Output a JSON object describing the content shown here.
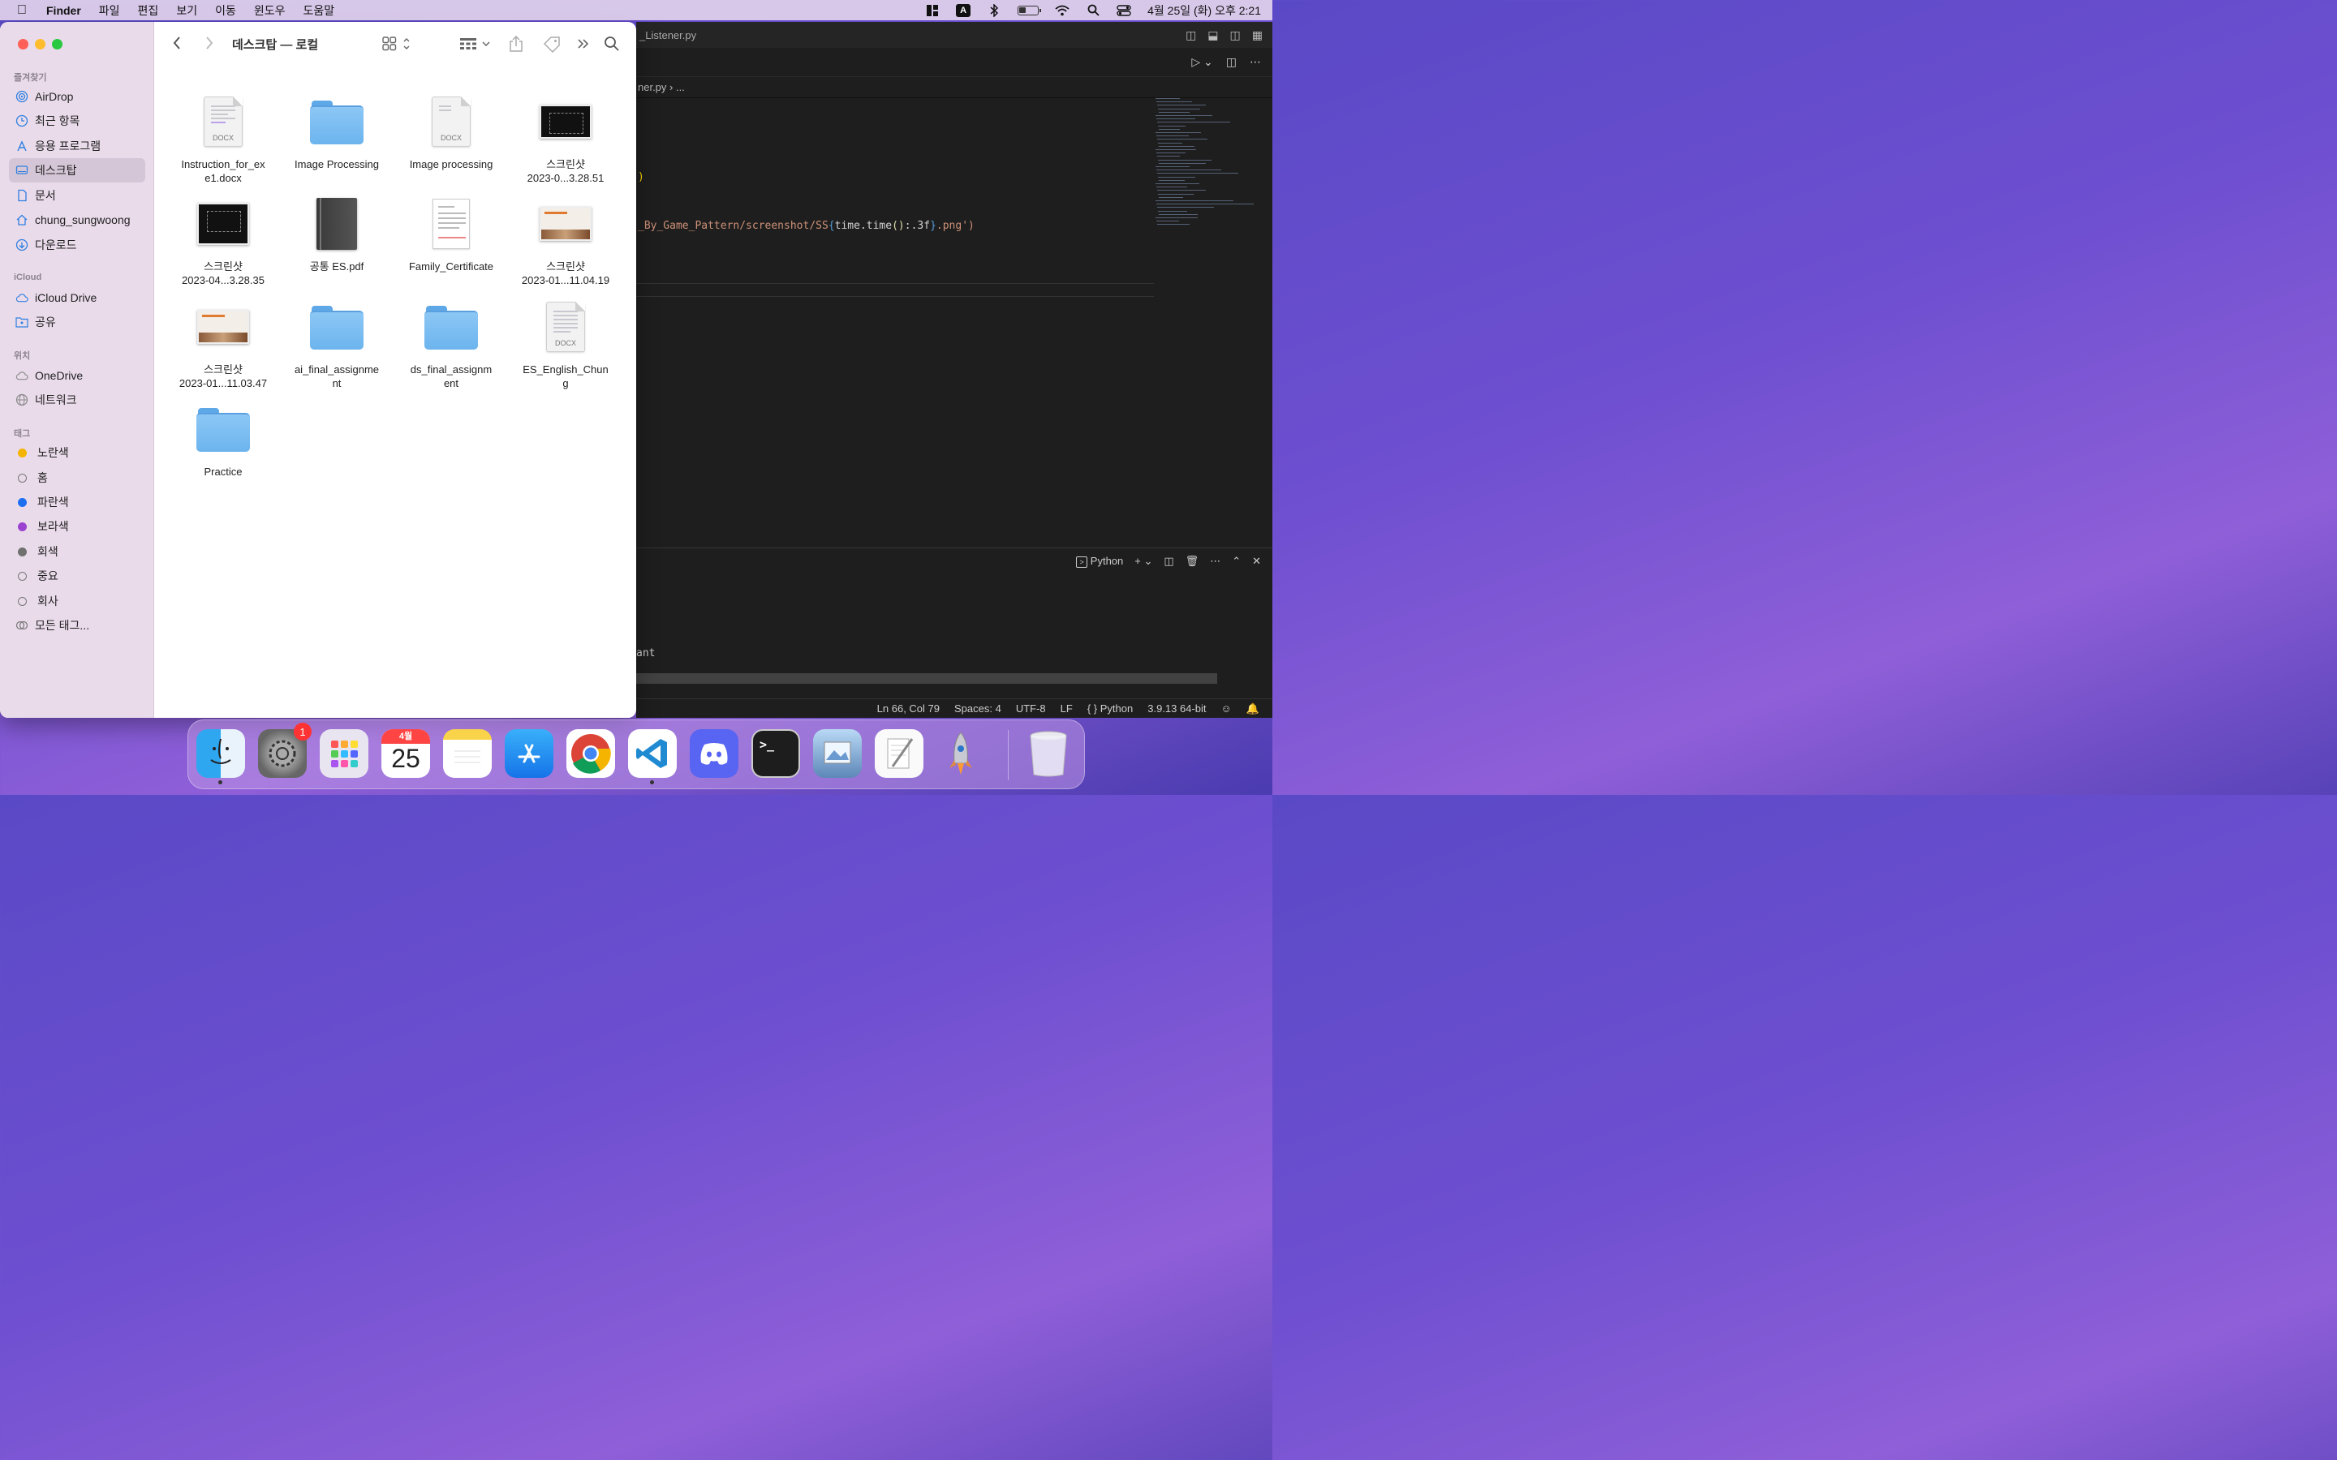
{
  "menubar": {
    "app_name": "Finder",
    "menus": [
      "파일",
      "편집",
      "보기",
      "이동",
      "윈도우",
      "도움말"
    ],
    "input_indicator": "A",
    "clock": "4월 25일 (화) 오후 2:21"
  },
  "vscode": {
    "tab_title": "_Listener.py",
    "breadcrumb": "ner.py",
    "breadcrumb_tail": "...",
    "code_line_1": ")",
    "code_line_2_prefix": "_By_Game_Pattern/screenshot/SS",
    "code_line_2_brace_open": "{",
    "code_line_2_expr": "time.time",
    "code_line_2_paren": "()",
    "code_line_2_fmt": ":.3f",
    "code_line_2_brace_close": "}",
    "code_line_2_suffix": ".png')",
    "panel_terminal_label": "Python",
    "panel_output": "ant",
    "status": {
      "position": "Ln 66, Col 79",
      "spaces": "Spaces: 4",
      "encoding": "UTF-8",
      "eol": "LF",
      "language": "Python",
      "interpreter": "3.9.13 64-bit"
    }
  },
  "finder": {
    "title": "데스크탑 — 로컬",
    "sidebar": {
      "favorites_header": "즐겨찾기",
      "favorites": [
        {
          "label": "AirDrop",
          "icon": "airdrop-icon"
        },
        {
          "label": "최근 항목",
          "icon": "clock-icon"
        },
        {
          "label": "응용 프로그램",
          "icon": "applications-icon"
        },
        {
          "label": "데스크탑",
          "icon": "desktop-icon",
          "active": true
        },
        {
          "label": "문서",
          "icon": "document-icon"
        },
        {
          "label": "chung_sungwoong",
          "icon": "home-icon"
        },
        {
          "label": "다운로드",
          "icon": "download-icon"
        }
      ],
      "icloud_header": "iCloud",
      "icloud": [
        {
          "label": "iCloud Drive",
          "icon": "cloud-icon"
        },
        {
          "label": "공유",
          "icon": "shared-folder-icon"
        }
      ],
      "locations_header": "위치",
      "locations": [
        {
          "label": "OneDrive",
          "icon": "cloud-icon"
        },
        {
          "label": "네트워크",
          "icon": "network-icon"
        }
      ],
      "tags_header": "태그",
      "tags": [
        {
          "label": "노란색",
          "color": "#f5b400"
        },
        {
          "label": "홈",
          "color": ""
        },
        {
          "label": "파란색",
          "color": "#1e6ff0"
        },
        {
          "label": "보라색",
          "color": "#9c42d0"
        },
        {
          "label": "회색",
          "color": "#707070"
        },
        {
          "label": "중요",
          "color": ""
        },
        {
          "label": "회사",
          "color": ""
        },
        {
          "label": "모든 태그...",
          "color": ""
        }
      ]
    },
    "files": [
      {
        "line1": "Instruction_for_ex",
        "line2": "e1.docx",
        "kind": "docx"
      },
      {
        "line1": "Image Processing",
        "line2": "",
        "kind": "folder"
      },
      {
        "line1": "Image processing",
        "line2": "",
        "kind": "docx"
      },
      {
        "line1": "스크린샷",
        "line2": "2023-0...3.28.51",
        "kind": "shot-dark"
      },
      {
        "line1": "스크린샷",
        "line2": "2023-04...3.28.35",
        "kind": "shot-dark"
      },
      {
        "line1": "공통 ES.pdf",
        "line2": "",
        "kind": "pdf"
      },
      {
        "line1": "Family_Certificate",
        "line2": "",
        "kind": "cert"
      },
      {
        "line1": "스크린샷",
        "line2": "2023-01...11.04.19",
        "kind": "shot-light"
      },
      {
        "line1": "스크린샷",
        "line2": "2023-01...11.03.47",
        "kind": "shot-light"
      },
      {
        "line1": "ai_final_assignme",
        "line2": "nt",
        "kind": "folder"
      },
      {
        "line1": "ds_final_assignm",
        "line2": "ent",
        "kind": "folder"
      },
      {
        "line1": "ES_English_Chun",
        "line2": "g",
        "kind": "docx"
      },
      {
        "line1": "Practice",
        "line2": "",
        "kind": "folder"
      }
    ],
    "docx_label": "DOCX"
  },
  "dock": {
    "settings_badge": "1",
    "calendar_month": "4월",
    "calendar_day": "25",
    "apps": [
      "finder-icon",
      "system-settings-icon",
      "launchpad-icon",
      "calendar-icon",
      "notes-icon",
      "app-store-icon",
      "chrome-icon",
      "vscode-icon",
      "discord-icon",
      "terminal-icon",
      "preview-icon",
      "textedit-icon",
      "rocket-icon",
      "trash-icon"
    ]
  }
}
